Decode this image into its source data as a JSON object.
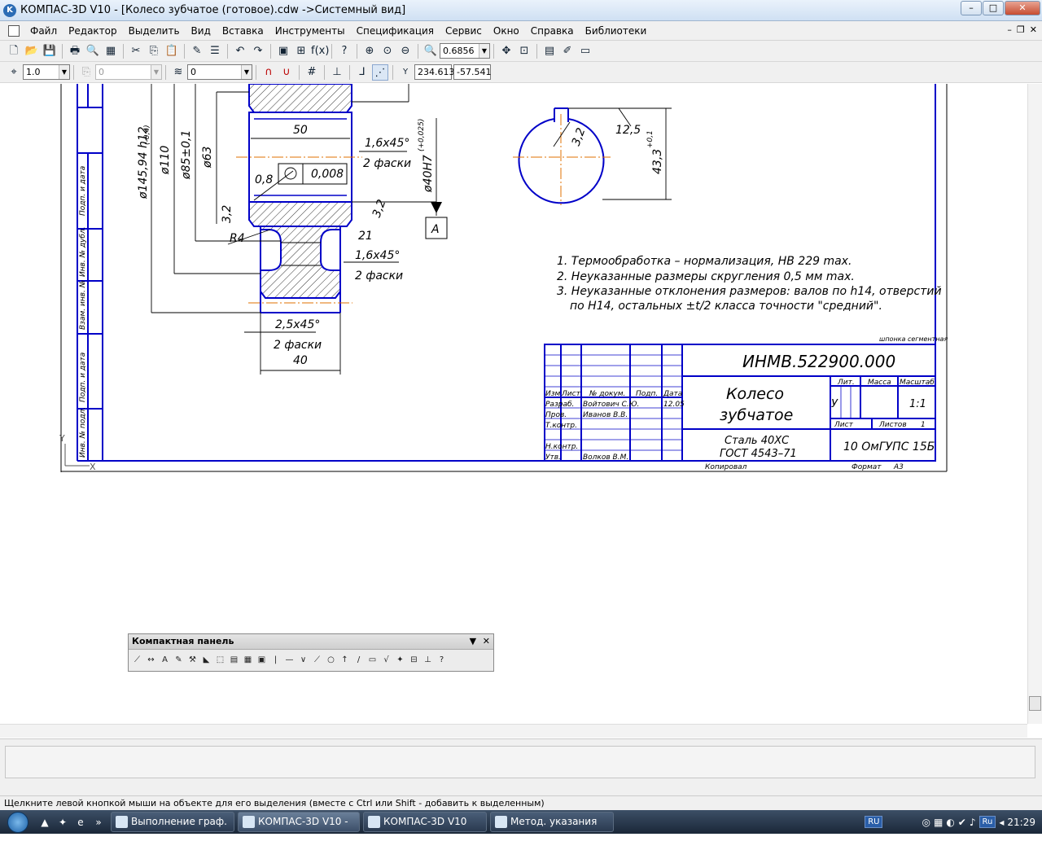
{
  "titlebar": {
    "app_icon": "kompas-logo-icon",
    "title": "КОМПАС-3D V10 - [Колесо зубчатое (готовое).cdw ->Системный вид]",
    "minimize": "–",
    "maximize": "□",
    "close": "✕"
  },
  "menu": {
    "items": [
      "Файл",
      "Редактор",
      "Выделить",
      "Вид",
      "Вставка",
      "Инструменты",
      "Спецификация",
      "Сервис",
      "Окно",
      "Справка",
      "Библиотеки"
    ]
  },
  "toolbar1": {
    "zoom": "0.6856"
  },
  "toolbar2": {
    "style_value": "1.0",
    "layer_value": "0",
    "view_value": "0",
    "coord_label": "Y",
    "x_coord": "234.613",
    "y_coord": "-57.541"
  },
  "drawing": {
    "dim_50": "50",
    "dim_16x45_top": "1,6x45°",
    "dim_2_faski_top": "2 фаски",
    "dim_phi40": "ø40H7",
    "dim_phi40_tol": "(+0,025)",
    "dim_0_8": "0,8",
    "dim_0_008": "0,008",
    "dim_3_2_left": "3,2",
    "dim_3_2_right": "3,2",
    "dim_R4": "R4",
    "dim_21": "21",
    "dim_16x45_mid": "1,6x45°",
    "dim_2_faski_mid": "2 фаски",
    "dim_25x45": "2,5x45°",
    "dim_2_faski_bot": "2 фаски",
    "dim_40": "40",
    "dim_phi145": "ø145,94 h12",
    "dim_phi145_tol": "(-0,4)",
    "dim_phi110": "ø110",
    "dim_phi85": "ø85±0,1",
    "dim_phi63": "ø63",
    "datum_A": "A",
    "dim_12_5": "12,5",
    "dim_3_2_key": "3,2",
    "dim_43_3": "43,3",
    "dim_43_3_tol": "+0,1",
    "notes": [
      "1. Термообработка – нормализация, НВ 229 max.",
      "2. Неуказанные размеры скругления 0,5 мм max.",
      "3. Неуказанные отклонения размеров: валов по h14, отверстий",
      "    по Н14, остальных ±t/2 класса точности \"средний\"."
    ],
    "small_note": "шпонка сегментная",
    "side_labels": [
      "Подп. и дата",
      "Инв. № дубл.",
      "Взам. инв. №",
      "Подп. и дата",
      "Инв. № подл."
    ],
    "title_block": {
      "designation": "ИНМВ.522900.000",
      "name_line1": "Колесо",
      "name_line2": "зубчатое",
      "material_line1": "Сталь 40ХС",
      "material_line2": "ГОСТ 4543–71",
      "org": "10 ОмГУПС 15Б",
      "lit": "Лит.",
      "mass": "Масса",
      "scale": "Масштаб",
      "scale_value": "1:1",
      "lit_value": "У",
      "sheet": "Лист",
      "sheets": "Листов",
      "sheets_value": "1",
      "hdr_izm": "Изм",
      "hdr_list": "Лист",
      "hdr_doc": "№ докум.",
      "hdr_sign": "Подп.",
      "hdr_date": "Дата",
      "razrab": "Разраб.",
      "razrab_name": "Войтович С.Ю.",
      "razrab_date": "12.05",
      "prov": "Пров.",
      "prov_name": "Иванов В.В.",
      "tkontr": "Т.контр.",
      "nkontr": "Н.контр.",
      "utv": "Утв.",
      "utv_name": "Волков В.М.",
      "copied": "Копировал",
      "format": "Формат",
      "format_value": "А3"
    },
    "axis_y": "Y",
    "axis_x": "X"
  },
  "compact_panel": {
    "title": "Компактная панель"
  },
  "statusbar": {
    "hint": "Щелкните левой кнопкой мыши на объекте для его выделения (вместе с Ctrl или Shift - добавить к выделенным)"
  },
  "taskbar": {
    "tasks": [
      "Выполнение граф. ...",
      "КОМПАС-3D V10 - [...",
      "КОМПАС-3D V10",
      "Метод. указания"
    ],
    "lang": "RU",
    "lang2": "Ru",
    "clock": "21:29"
  }
}
